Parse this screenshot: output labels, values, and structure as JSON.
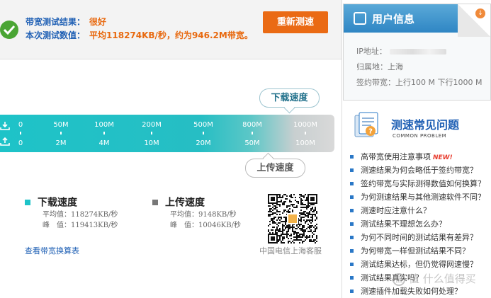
{
  "result": {
    "bandwidth_label": "带宽测试结果：",
    "bandwidth_value": "很好",
    "speed_label": "本次测试数值：",
    "speed_value": "平均118274KB/秒，约为946.2M带宽。",
    "retest_button": "重新测速"
  },
  "gauge": {
    "download_bubble": "下载速度",
    "upload_bubble": "上传速度",
    "download_ticks": [
      "0",
      "50M",
      "100M",
      "200M",
      "500M",
      "800M",
      "1000M"
    ],
    "upload_ticks": [
      "0",
      "2M",
      "4M",
      "10M",
      "20M",
      "50M",
      "100M"
    ]
  },
  "stats": {
    "download": {
      "title": "下载速度",
      "avg": "平均值：118274KB/秒",
      "peak": "峰　值：119413KB/秒",
      "color": "#1ec3c8"
    },
    "upload": {
      "title": "上传速度",
      "avg": "平均值：9148KB/秒",
      "peak": "峰　值：10046KB/秒",
      "color": "#777777"
    },
    "convert_link": "查看带宽换算表"
  },
  "qr": {
    "caption": "中国电信上海客服"
  },
  "user_info": {
    "title": "用户信息",
    "ip_label": "IP地址：",
    "location": "归属地：上海",
    "contract": "签约带宽：上行100 M 下行1000 M"
  },
  "faq": {
    "title": "测速常见问题",
    "subtitle": "COMMON PROBLEM",
    "new_tag": "NEW!",
    "items": [
      "高带宽使用注意事项",
      "测速结果为何会略低于签约带宽？",
      "签约带宽与实际测得数值如何换算？",
      "为何测速结果与其他测速软件不同？",
      "测速时应注意什么？",
      "测试结果不理想怎么办？",
      "为何不同时间的测试结果有差异？",
      "为何带宽一样但测试结果不同？",
      "测试结果达标，但仍觉得网速慢？",
      "测试结果真实吗？",
      "测速插件加载失败如何处理？"
    ]
  },
  "watermark": "值 什么值得买",
  "colors": {
    "accent_blue": "#1e5fb4",
    "accent_orange": "#ea6a14",
    "gauge_teal": "#1ec3c8",
    "ok_green": "#4aa534"
  }
}
